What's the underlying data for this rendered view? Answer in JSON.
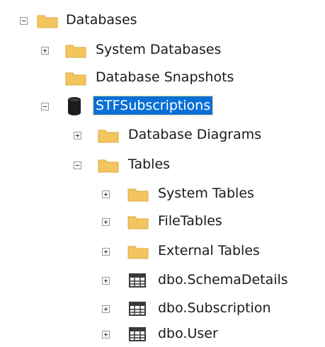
{
  "tree": {
    "databases": {
      "label": "Databases",
      "icon": "folder-icon",
      "state": "expanded"
    },
    "system_databases": {
      "label": "System Databases",
      "icon": "folder-icon",
      "state": "collapsed"
    },
    "database_snapshots": {
      "label": "Database Snapshots",
      "icon": "folder-icon",
      "state": "leaf"
    },
    "stf_subscriptions": {
      "label": "STFSubscriptions",
      "icon": "database-icon",
      "state": "expanded",
      "selected": true
    },
    "database_diagrams": {
      "label": "Database Diagrams",
      "icon": "folder-icon",
      "state": "collapsed"
    },
    "tables": {
      "label": "Tables",
      "icon": "folder-icon",
      "state": "expanded"
    },
    "system_tables": {
      "label": "System Tables",
      "icon": "folder-icon",
      "state": "collapsed"
    },
    "file_tables": {
      "label": "FileTables",
      "icon": "folder-icon",
      "state": "collapsed"
    },
    "external_tables": {
      "label": "External Tables",
      "icon": "folder-icon",
      "state": "collapsed"
    },
    "schema_details": {
      "label": "dbo.SchemaDetails",
      "icon": "table-icon",
      "state": "collapsed"
    },
    "subscription": {
      "label": "dbo.Subscription",
      "icon": "table-icon",
      "state": "collapsed"
    },
    "user": {
      "label": "dbo.User",
      "icon": "table-icon",
      "state": "collapsed"
    }
  },
  "colors": {
    "folder": "#f3c55f",
    "selection": "#0a6fd6",
    "database": "#1c1c1c",
    "table_grid": "#3a3a3a"
  }
}
